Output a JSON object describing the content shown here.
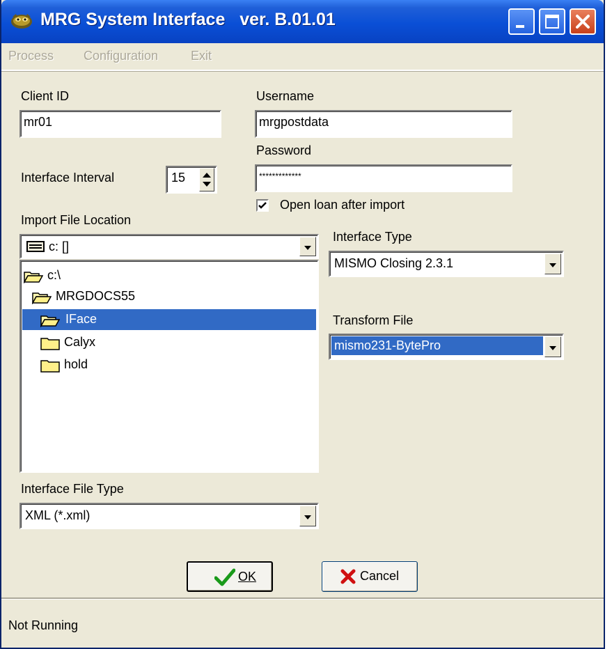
{
  "window": {
    "title": "MRG System Interface   ver. B.01.01"
  },
  "menu": {
    "items": [
      {
        "label": "Process"
      },
      {
        "label": "Configuration"
      },
      {
        "label": "Exit"
      }
    ]
  },
  "form": {
    "client_id": {
      "label": "Client ID",
      "value": "mr01"
    },
    "username": {
      "label": "Username",
      "value": "mrgpostdata"
    },
    "password": {
      "label": "Password",
      "value": "*************"
    },
    "interface_interval": {
      "label": "Interface Interval",
      "value": "15"
    },
    "open_loan": {
      "label": "Open loan after import",
      "checked": true
    },
    "import_location": {
      "label": "Import File Location",
      "drive": "c: []"
    },
    "directories": [
      {
        "name": "c:\\",
        "open": true,
        "selected": false
      },
      {
        "name": "MRGDOCS55",
        "open": true,
        "selected": false
      },
      {
        "name": "IFace",
        "open": true,
        "selected": true
      },
      {
        "name": "Calyx",
        "open": false,
        "selected": false
      },
      {
        "name": "hold",
        "open": false,
        "selected": false
      }
    ],
    "interface_type": {
      "label": "Interface Type",
      "value": "MISMO Closing 2.3.1"
    },
    "transform_file": {
      "label": "Transform File",
      "value": "mismo231-BytePro"
    },
    "interface_file_type": {
      "label": "Interface File Type",
      "value": "XML (*.xml)"
    }
  },
  "buttons": {
    "ok": "OK",
    "cancel": "Cancel"
  },
  "status": {
    "text": "Not Running"
  },
  "colors": {
    "title_bar": "#0a4fd6",
    "selection": "#316ac5",
    "window_bg": "#ece9d8"
  }
}
